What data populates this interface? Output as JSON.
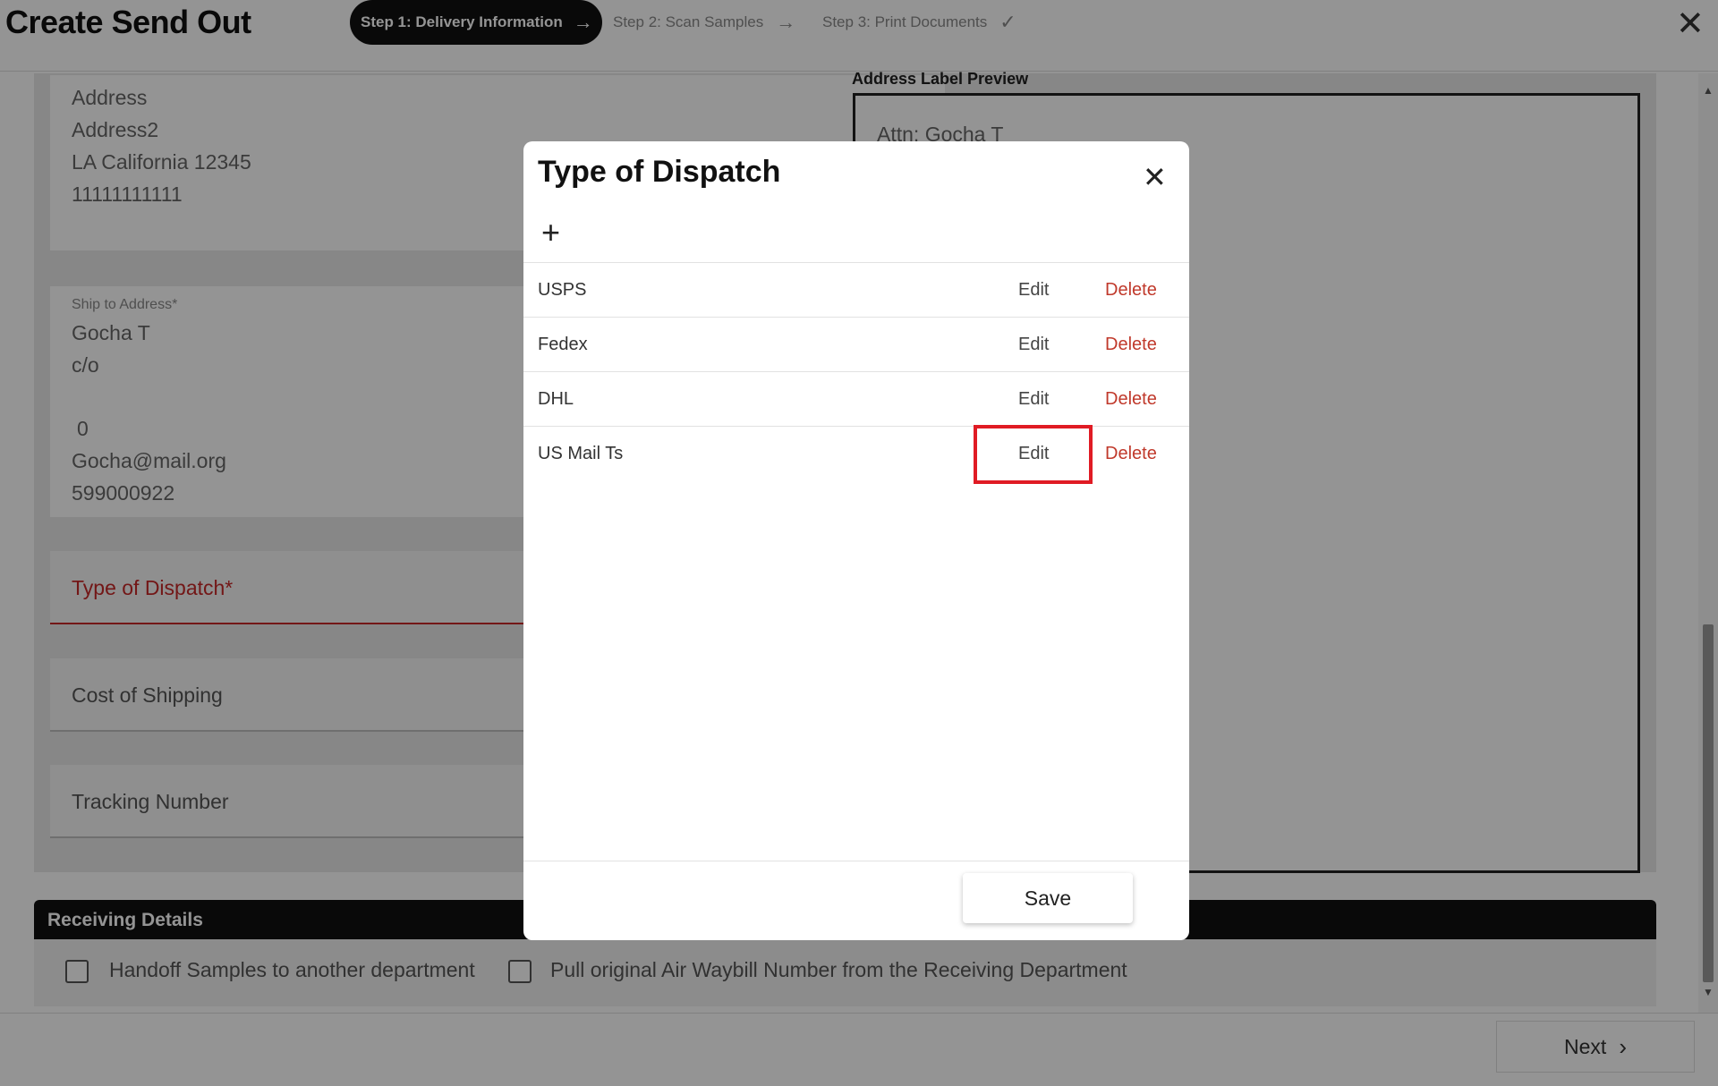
{
  "header": {
    "title": "Create Send Out",
    "steps": [
      {
        "label": "Step 1: Delivery Information",
        "icon": "arrow-right-icon"
      },
      {
        "label": "Step 2: Scan Samples",
        "icon": "arrow-right-icon"
      },
      {
        "label": "Step 3: Print Documents",
        "icon": "checkmark-icon"
      }
    ],
    "close_icon": "close-icon"
  },
  "sender_address": {
    "lines": [
      "Address",
      "Address2",
      "LA California 12345",
      "11111111111"
    ]
  },
  "ship_to": {
    "label": "Ship to Address*",
    "lines": [
      "Gocha T",
      "c/o",
      "0",
      "Gocha@mail.org",
      "599000922"
    ]
  },
  "fields": {
    "type_of_dispatch": "Type of Dispatch*",
    "cost_of_shipping": "Cost of Shipping",
    "tracking_number": "Tracking Number"
  },
  "preview": {
    "title": "Address Label Preview",
    "attn": "Attn: Gocha T"
  },
  "receiving": {
    "title": "Receiving Details",
    "checkbox1": "Handoff Samples to another department",
    "checkbox2": "Pull original Air Waybill Number from the Receiving Department"
  },
  "footer": {
    "next": "Next"
  },
  "modal": {
    "title": "Type of Dispatch",
    "add_icon": "plus-icon",
    "edit_label": "Edit",
    "delete_label": "Delete",
    "rows": [
      "USPS",
      "Fedex",
      "DHL",
      "US Mail Ts"
    ],
    "highlighted_row": "US Mail Ts",
    "save": "Save"
  },
  "colors": {
    "error": "#c62828",
    "delete": "#c0392b",
    "highlight": "#e01b24"
  }
}
